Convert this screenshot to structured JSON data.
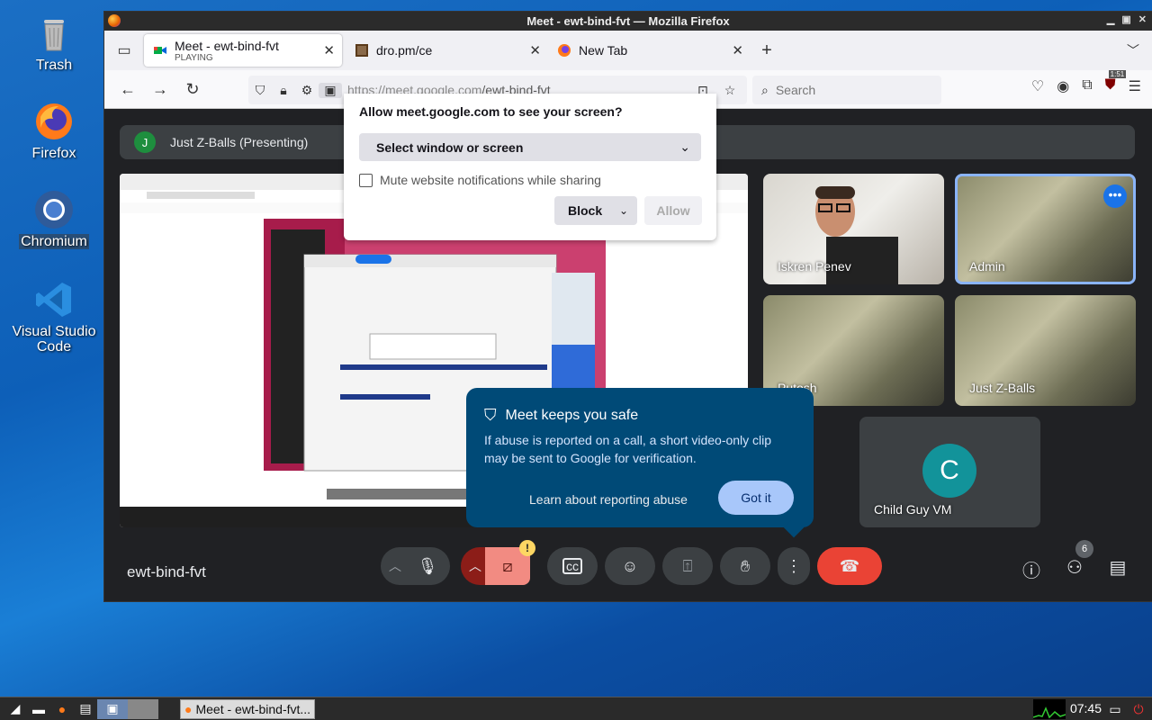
{
  "desktop": {
    "icons": [
      {
        "label": "Trash"
      },
      {
        "label": "Firefox"
      },
      {
        "label": "Chromium"
      },
      {
        "label": "Visual Studio Code"
      }
    ]
  },
  "window": {
    "title": "Meet - ewt-bind-fvt — Mozilla Firefox"
  },
  "tabs": [
    {
      "label": "Meet - ewt-bind-fvt",
      "sublabel": "PLAYING"
    },
    {
      "label": "dro.pm/ce"
    },
    {
      "label": "New Tab"
    }
  ],
  "navbar": {
    "url_prefix": "https://meet.google.com",
    "url_path": "/ewt-bind-fvt",
    "search_placeholder": "Search",
    "badge_count": "1:51"
  },
  "permission_prompt": {
    "question": "Allow meet.google.com to see your screen?",
    "select_label": "Select window or screen",
    "mute_label": "Mute website notifications while sharing",
    "block_label": "Block",
    "allow_label": "Allow"
  },
  "meet": {
    "presenter": {
      "initial": "J",
      "label": "Just Z-Balls (Presenting)"
    },
    "participants": [
      {
        "name": "Iskren Penev"
      },
      {
        "name": "Admin"
      },
      {
        "name": "Putosh"
      },
      {
        "name": "Just Z-Balls"
      },
      {
        "name": "Child Guy VM",
        "initial": "C"
      }
    ],
    "meeting_code": "ewt-bind-fvt",
    "people_count": "6",
    "safety_popup": {
      "title": "Meet keeps you safe",
      "body": "If abuse is reported on a call, a short video-only clip may be sent to Google for verification.",
      "learn_link": "Learn about reporting abuse",
      "got_it": "Got it"
    },
    "camera_warning": "!"
  },
  "taskbar": {
    "task_label": "Meet - ewt-bind-fvt...",
    "clock": "07:45"
  }
}
